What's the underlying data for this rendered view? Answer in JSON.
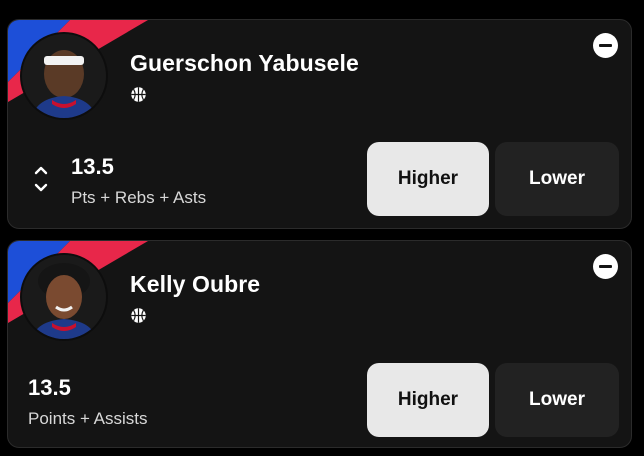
{
  "cards": [
    {
      "player_name": "Guerschon Yabusele",
      "sport_icon": "basketball-icon",
      "stat_value": "13.5",
      "stat_label": "Pts + Rebs + Asts",
      "higher_label": "Higher",
      "lower_label": "Lower",
      "has_chevrons": true
    },
    {
      "player_name": "Kelly Oubre",
      "sport_icon": "basketball-icon",
      "stat_value": "13.5",
      "stat_label": "Points + Assists",
      "higher_label": "Higher",
      "lower_label": "Lower",
      "has_chevrons": false
    }
  ],
  "colors": {
    "team_blue": "#1d4fd8",
    "team_red": "#e8274a",
    "card_bg": "#141414",
    "higher_bg": "#e8e8e8",
    "lower_bg": "#222222"
  }
}
